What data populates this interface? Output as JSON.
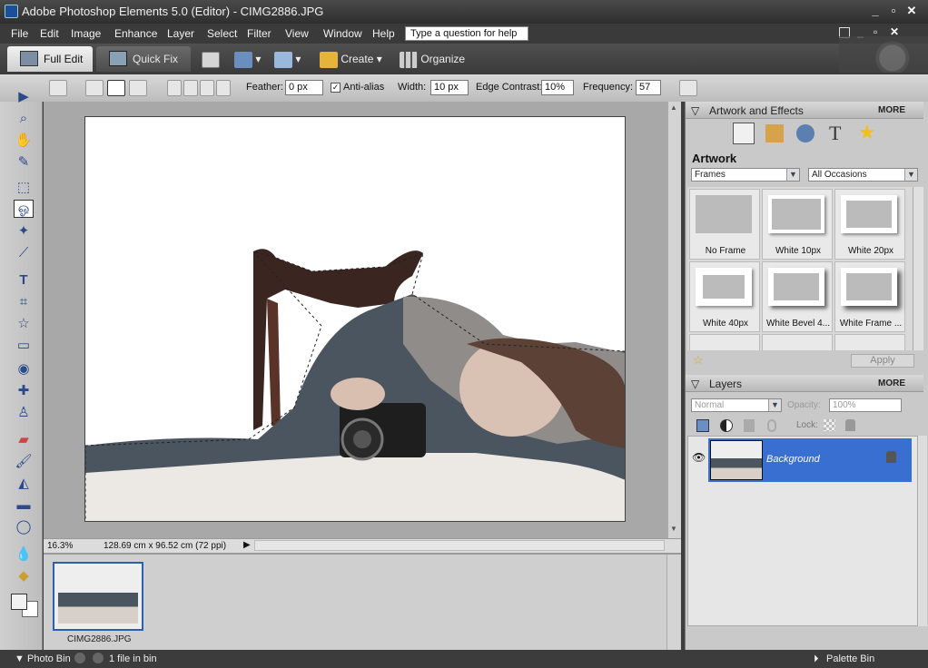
{
  "window": {
    "title": "Adobe Photoshop Elements 5.0 (Editor) - CIMG2886.JPG"
  },
  "menu": [
    "File",
    "Edit",
    "Image",
    "Enhance",
    "Layer",
    "Select",
    "Filter",
    "View",
    "Window",
    "Help"
  ],
  "help": {
    "placeholder": "Type a question for help"
  },
  "modes": {
    "full_edit": "Full Edit",
    "quick_fix": "Quick Fix",
    "create": "Create",
    "organize": "Organize"
  },
  "options": {
    "feather_label": "Feather:",
    "feather_value": "0 px",
    "antialias_label": "Anti-alias",
    "width_label": "Width:",
    "width_value": "10 px",
    "edge_label": "Edge Contrast:",
    "edge_value": "10%",
    "freq_label": "Frequency:",
    "freq_value": "57"
  },
  "status": {
    "zoom": "16.3%",
    "doc_size": "128.69 cm x 96.52 cm (72 ppi)"
  },
  "photobin": {
    "filename": "CIMG2886.JPG"
  },
  "bottom": {
    "photo_bin": "Photo Bin",
    "count": "1 file in bin",
    "palette_bin": "Palette Bin"
  },
  "artwork": {
    "header": "Artwork and Effects",
    "more": "MORE",
    "title": "Artwork",
    "category": "Frames",
    "occasion": "All Occasions",
    "items": [
      "No Frame",
      "White 10px",
      "White 20px",
      "White 40px",
      "White Bevel 4...",
      "White Frame ..."
    ],
    "apply": "Apply"
  },
  "layers": {
    "header": "Layers",
    "more": "MORE",
    "blend_mode": "Normal",
    "opacity_label": "Opacity:",
    "opacity_value": "100%",
    "lock_label": "Lock:",
    "layer_name": "Background"
  }
}
